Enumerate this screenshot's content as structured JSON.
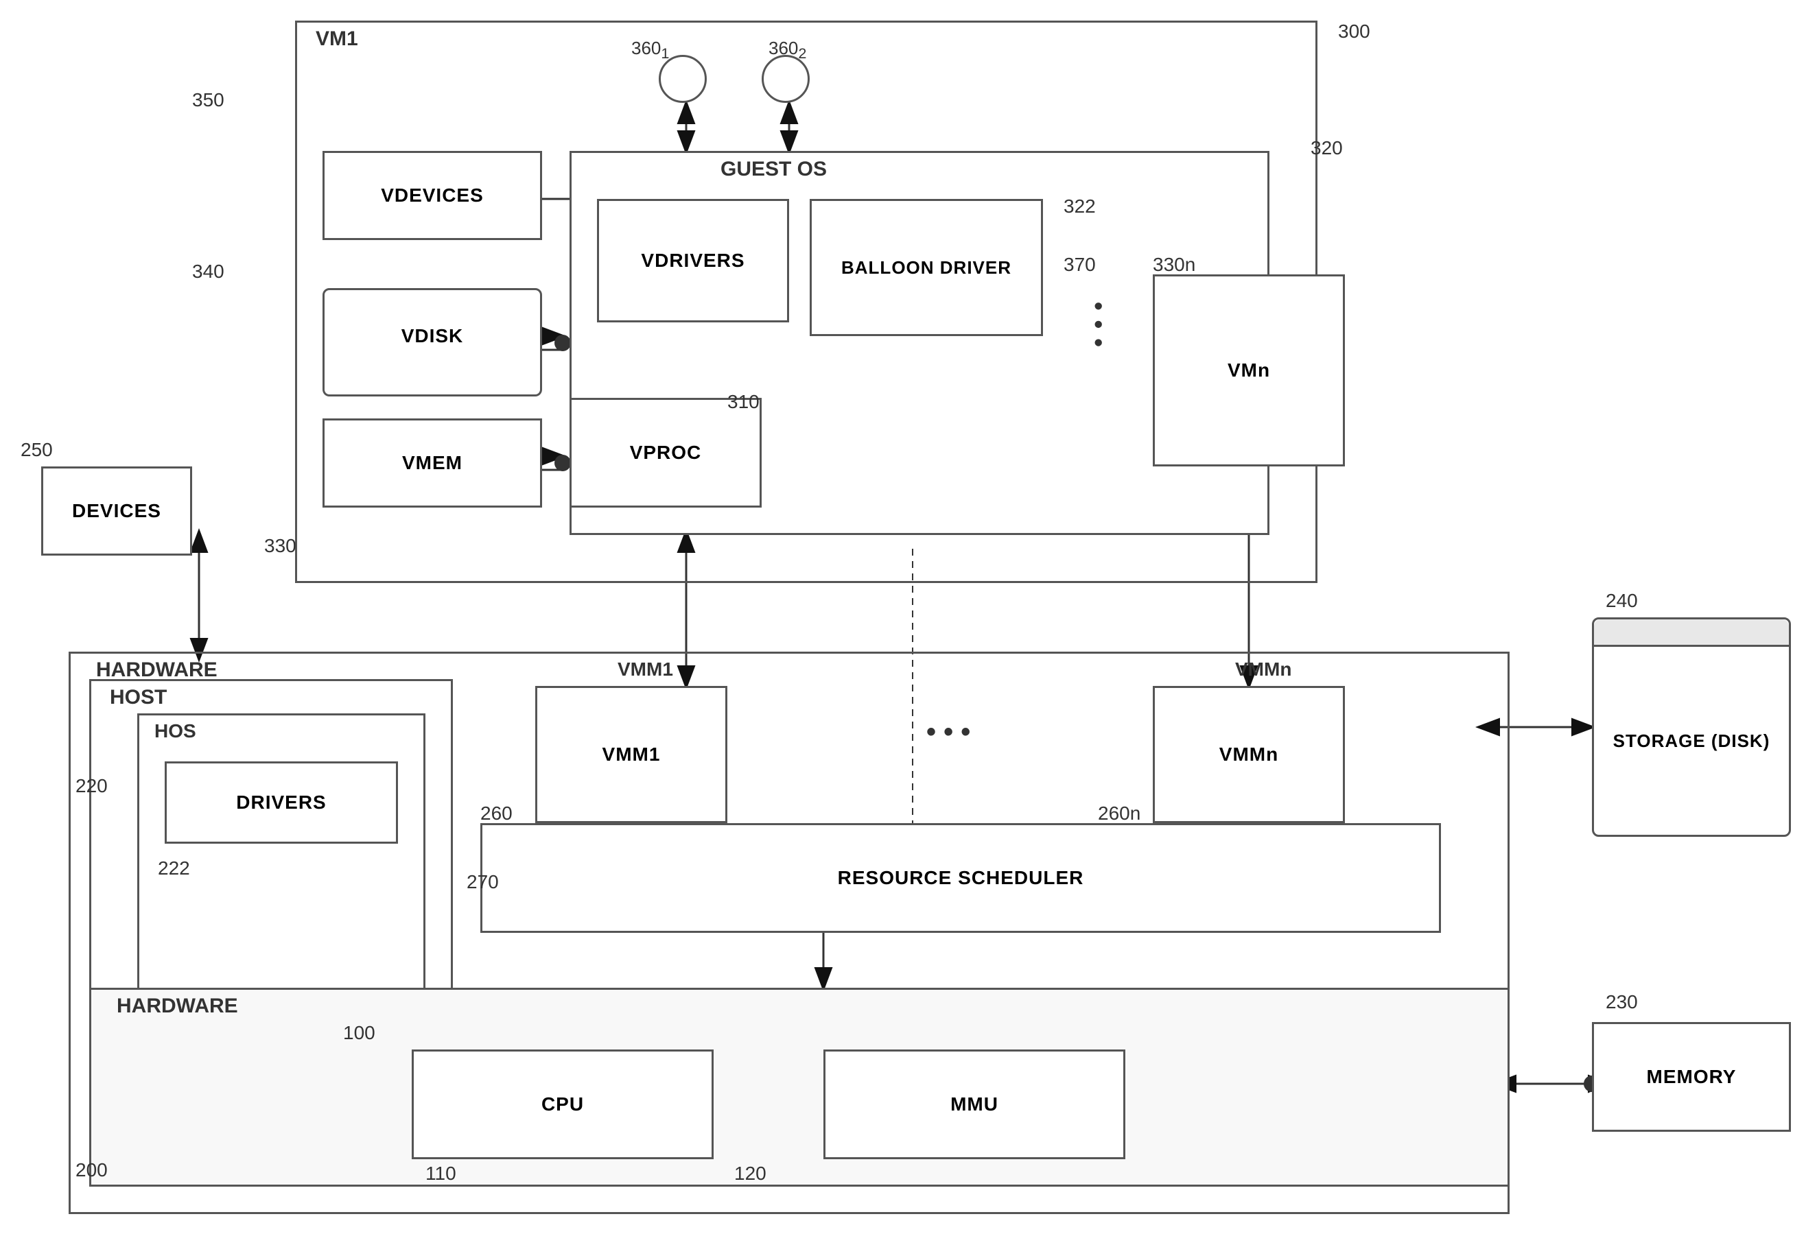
{
  "labels": {
    "vm1": "VM1",
    "guest_os": "GUEST OS",
    "vdevices": "VDEVICES",
    "vdisk": "VDISK",
    "vmem": "VMEM",
    "vproc": "VPROC",
    "vdrivers": "VDRIVERS",
    "balloon_driver": "BALLOON DRIVER",
    "vmn": "VMn",
    "host": "HOST",
    "hos": "HOS",
    "drivers": "DRIVERS",
    "vmm1": "VMM1",
    "vmmn": "VMMn",
    "resource_scheduler": "RESOURCE SCHEDULER",
    "hardware": "HARDWARE",
    "cpu": "CPU",
    "mmu": "MMU",
    "devices": "DEVICES",
    "storage": "STORAGE (DISK)",
    "memory": "MEMORY",
    "ref_300": "300",
    "ref_320": "320",
    "ref_322": "322",
    "ref_330n": "330n",
    "ref_350": "350",
    "ref_340": "340",
    "ref_250": "250",
    "ref_330": "330",
    "ref_310": "310",
    "ref_370": "370",
    "ref_220": "220",
    "ref_222": "222",
    "ref_260": "260",
    "ref_260n": "260n",
    "ref_270": "270",
    "ref_200": "200",
    "ref_100": "100",
    "ref_110": "110",
    "ref_120": "120",
    "ref_230": "230",
    "ref_240": "240"
  }
}
